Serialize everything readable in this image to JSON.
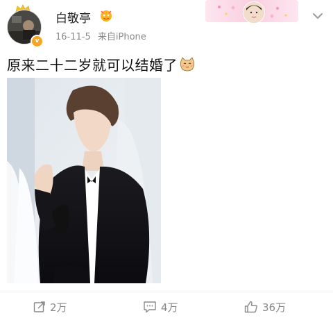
{
  "post": {
    "username": "白敬亭",
    "date": "16-11-5",
    "source": "来自iPhone",
    "text": "原来二十二岁就可以结婚了"
  },
  "actions": {
    "repost_count": "2万",
    "comment_count": "4万",
    "like_count": "36万"
  },
  "colors": {
    "text_primary": "#222222",
    "text_meta": "#8a8a8a",
    "verified_badge": "#f6a623",
    "fan_card_pink": "#f9cfe0"
  },
  "icons": [
    "crown-icon",
    "verified-icon",
    "vip-badge-icon",
    "more-icon",
    "cat-emoji-icon",
    "repost-icon",
    "comment-icon",
    "like-icon"
  ]
}
